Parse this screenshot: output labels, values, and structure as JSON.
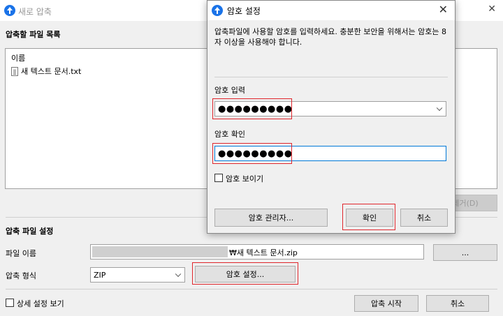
{
  "window": {
    "title": "새로 압축",
    "close_glyph": "✕"
  },
  "file_list": {
    "section_title": "압축할 파일 목록",
    "column_header": "이름",
    "files": [
      "새 텍스트 문서.txt"
    ],
    "remove_button": "제거(D)"
  },
  "settings": {
    "section_title": "압축 파일 설정",
    "filename_label": "파일 이름",
    "filename_value": "₩새 텍스트 문서.zip",
    "browse_button": "...",
    "format_label": "압축 형식",
    "format_value": "ZIP",
    "password_button": "암호 설정..."
  },
  "footer": {
    "advanced_checkbox_label": "상세 설정 보기",
    "start_button": "압축 시작",
    "cancel_button": "취소"
  },
  "dialog": {
    "title": "암호 설정",
    "close_glyph": "✕",
    "description": "압축파일에 사용할 암호를 입력하세요. 충분한 보안을 위해서는 암호는 8자 이상을 사용해야 합니다.",
    "password_label": "암호 입력",
    "password_value": "●●●●●●●●●",
    "confirm_label": "암호 확인",
    "confirm_value": "●●●●●●●●●",
    "show_password_label": "암호 보이기",
    "manager_button": "암호 관리자...",
    "ok_button": "확인",
    "cancel_button": "취소"
  },
  "colors": {
    "accent": "#1a73e8",
    "highlight": "#e0262c",
    "focus": "#0078d7"
  }
}
